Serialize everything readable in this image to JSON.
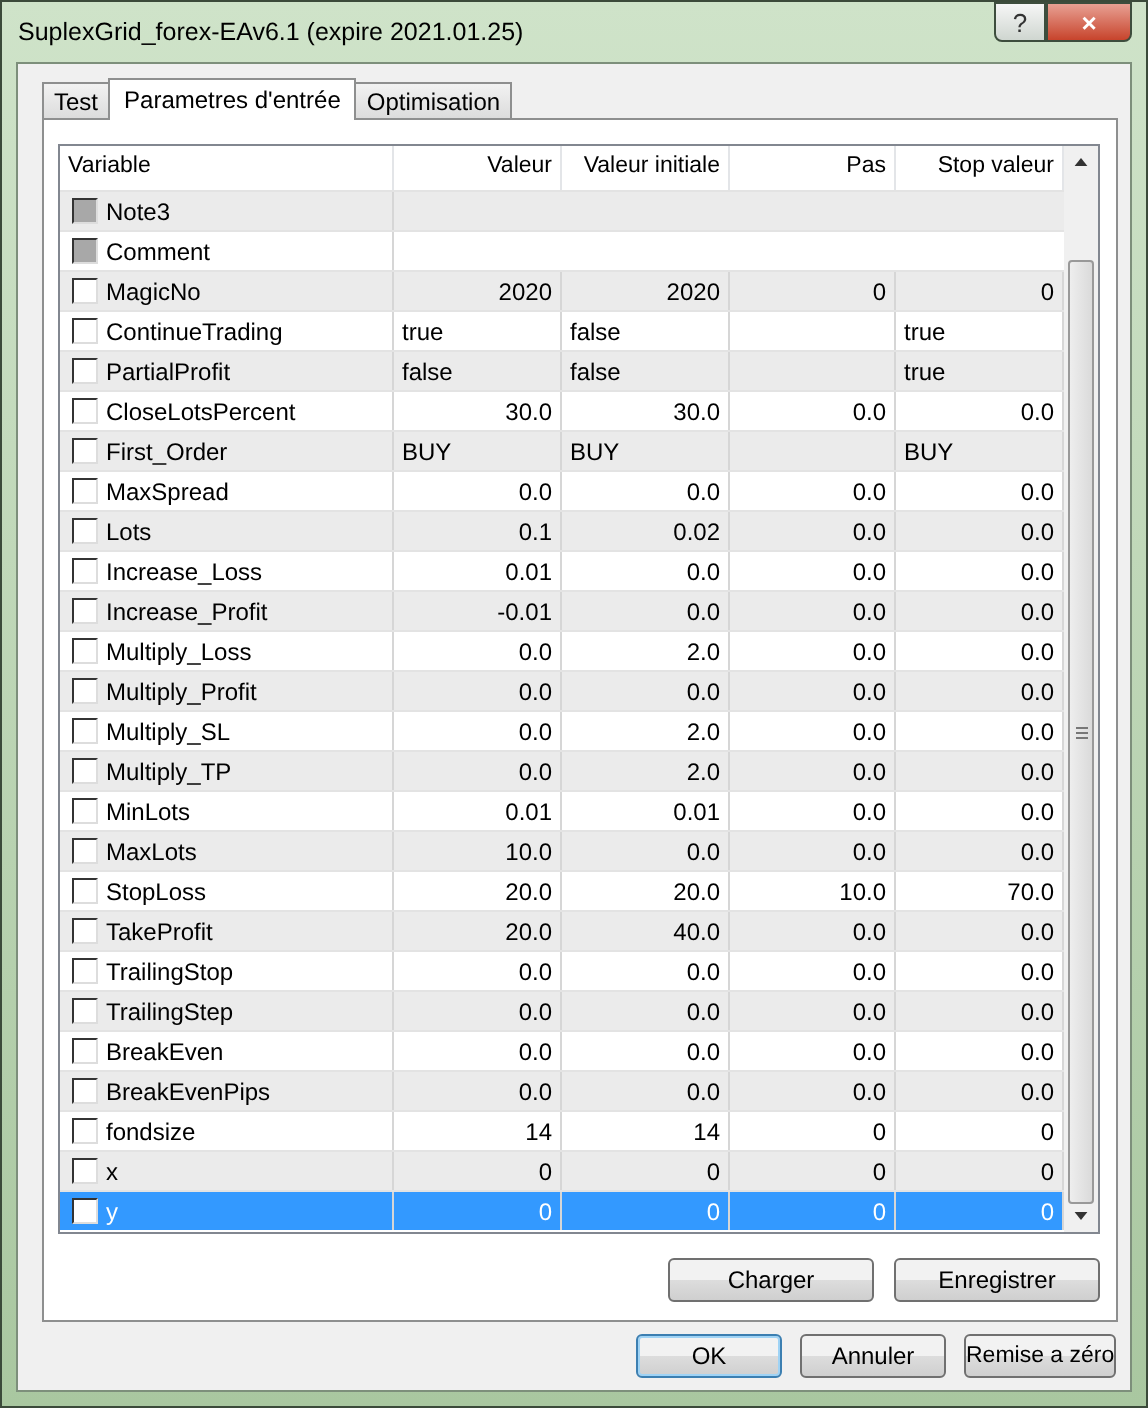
{
  "window": {
    "title": "SuplexGrid_forex-EAv6.1 (expire 2021.01.25)",
    "help": "?",
    "close": "×"
  },
  "tabs": [
    {
      "label": "Test",
      "selected": false
    },
    {
      "label": "Parametres d'entrée",
      "selected": true
    },
    {
      "label": "Optimisation",
      "selected": false
    }
  ],
  "table": {
    "columns": [
      "Variable",
      "Valeur",
      "Valeur initiale",
      "Pas",
      "Stop valeur"
    ],
    "rows": [
      {
        "kind": "note",
        "name": "Note3",
        "checked": false,
        "selected": false
      },
      {
        "kind": "note",
        "name": "Comment",
        "checked": false,
        "selected": false
      },
      {
        "kind": "number",
        "name": "MagicNo",
        "checked": false,
        "selected": false,
        "valeur": "2020",
        "valeur_initiale": "2020",
        "pas": "0",
        "stop_valeur": "0"
      },
      {
        "kind": "text",
        "name": "ContinueTrading",
        "checked": false,
        "selected": false,
        "valeur": "true",
        "valeur_initiale": "false",
        "stop_valeur": "true"
      },
      {
        "kind": "text",
        "name": "PartialProfit",
        "checked": false,
        "selected": false,
        "valeur": "false",
        "valeur_initiale": "false",
        "stop_valeur": "true"
      },
      {
        "kind": "number",
        "name": "CloseLotsPercent",
        "checked": false,
        "selected": false,
        "valeur": "30.0",
        "valeur_initiale": "30.0",
        "pas": "0.0",
        "stop_valeur": "0.0"
      },
      {
        "kind": "text",
        "name": "First_Order",
        "checked": false,
        "selected": false,
        "valeur": "BUY",
        "valeur_initiale": "BUY",
        "stop_valeur": "BUY"
      },
      {
        "kind": "number",
        "name": "MaxSpread",
        "checked": false,
        "selected": false,
        "valeur": "0.0",
        "valeur_initiale": "0.0",
        "pas": "0.0",
        "stop_valeur": "0.0"
      },
      {
        "kind": "number",
        "name": "Lots",
        "checked": false,
        "selected": false,
        "valeur": "0.1",
        "valeur_initiale": "0.02",
        "pas": "0.0",
        "stop_valeur": "0.0"
      },
      {
        "kind": "number",
        "name": "Increase_Loss",
        "checked": false,
        "selected": false,
        "valeur": "0.01",
        "valeur_initiale": "0.0",
        "pas": "0.0",
        "stop_valeur": "0.0"
      },
      {
        "kind": "number",
        "name": "Increase_Profit",
        "checked": false,
        "selected": false,
        "valeur": "-0.01",
        "valeur_initiale": "0.0",
        "pas": "0.0",
        "stop_valeur": "0.0"
      },
      {
        "kind": "number",
        "name": "Multiply_Loss",
        "checked": false,
        "selected": false,
        "valeur": "0.0",
        "valeur_initiale": "2.0",
        "pas": "0.0",
        "stop_valeur": "0.0"
      },
      {
        "kind": "number",
        "name": "Multiply_Profit",
        "checked": false,
        "selected": false,
        "valeur": "0.0",
        "valeur_initiale": "0.0",
        "pas": "0.0",
        "stop_valeur": "0.0"
      },
      {
        "kind": "number",
        "name": "Multiply_SL",
        "checked": false,
        "selected": false,
        "valeur": "0.0",
        "valeur_initiale": "2.0",
        "pas": "0.0",
        "stop_valeur": "0.0"
      },
      {
        "kind": "number",
        "name": "Multiply_TP",
        "checked": false,
        "selected": false,
        "valeur": "0.0",
        "valeur_initiale": "2.0",
        "pas": "0.0",
        "stop_valeur": "0.0"
      },
      {
        "kind": "number",
        "name": "MinLots",
        "checked": false,
        "selected": false,
        "valeur": "0.01",
        "valeur_initiale": "0.01",
        "pas": "0.0",
        "stop_valeur": "0.0"
      },
      {
        "kind": "number",
        "name": "MaxLots",
        "checked": false,
        "selected": false,
        "valeur": "10.0",
        "valeur_initiale": "0.0",
        "pas": "0.0",
        "stop_valeur": "0.0"
      },
      {
        "kind": "number",
        "name": "StopLoss",
        "checked": false,
        "selected": false,
        "valeur": "20.0",
        "valeur_initiale": "20.0",
        "pas": "10.0",
        "stop_valeur": "70.0"
      },
      {
        "kind": "number",
        "name": "TakeProfit",
        "checked": false,
        "selected": false,
        "valeur": "20.0",
        "valeur_initiale": "40.0",
        "pas": "0.0",
        "stop_valeur": "0.0"
      },
      {
        "kind": "number",
        "name": "TrailingStop",
        "checked": false,
        "selected": false,
        "valeur": "0.0",
        "valeur_initiale": "0.0",
        "pas": "0.0",
        "stop_valeur": "0.0"
      },
      {
        "kind": "number",
        "name": "TrailingStep",
        "checked": false,
        "selected": false,
        "valeur": "0.0",
        "valeur_initiale": "0.0",
        "pas": "0.0",
        "stop_valeur": "0.0"
      },
      {
        "kind": "number",
        "name": "BreakEven",
        "checked": false,
        "selected": false,
        "valeur": "0.0",
        "valeur_initiale": "0.0",
        "pas": "0.0",
        "stop_valeur": "0.0"
      },
      {
        "kind": "number",
        "name": "BreakEvenPips",
        "checked": false,
        "selected": false,
        "valeur": "0.0",
        "valeur_initiale": "0.0",
        "pas": "0.0",
        "stop_valeur": "0.0"
      },
      {
        "kind": "number",
        "name": "fondsize",
        "checked": false,
        "selected": false,
        "valeur": "14",
        "valeur_initiale": "14",
        "pas": "0",
        "stop_valeur": "0"
      },
      {
        "kind": "number",
        "name": "x",
        "checked": false,
        "selected": false,
        "valeur": "0",
        "valeur_initiale": "0",
        "pas": "0",
        "stop_valeur": "0"
      },
      {
        "kind": "number",
        "name": "y",
        "checked": false,
        "selected": true,
        "valeur": "0",
        "valeur_initiale": "0",
        "pas": "0",
        "stop_valeur": "0"
      }
    ]
  },
  "panel_buttons": [
    "Charger",
    "Enregistrer"
  ],
  "dialog_buttons": [
    {
      "label": "OK",
      "default": true
    },
    {
      "label": "Annuler",
      "default": false
    },
    {
      "label": "Remise a zéro",
      "default": false
    }
  ]
}
